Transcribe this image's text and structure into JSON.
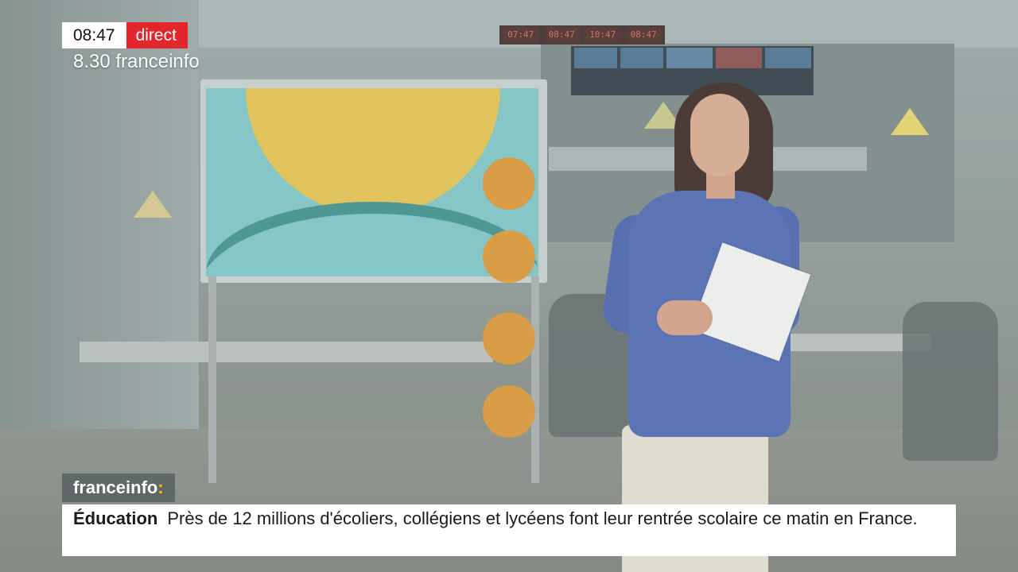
{
  "overlay": {
    "clock": "08:47",
    "live_label": "direct",
    "show_title": "8.30 franceinfo"
  },
  "background_clocks": [
    "07:47",
    "08:47",
    "10:47",
    "08:47"
  ],
  "brand": {
    "name": "franceinfo",
    "colon": ":"
  },
  "ticker": {
    "category": "Éducation",
    "headline": "Près de 12 millions d'écoliers, collégiens et lycéens font leur rentrée scolaire ce matin en France."
  },
  "colors": {
    "live_red": "#e3262c",
    "brand_yellow": "#f6c000",
    "screen_teal": "#7ec4c4",
    "screen_sun": "#e6c24e",
    "screen_dots": "#dc9434",
    "sweater_blue": "#4f67b0"
  }
}
